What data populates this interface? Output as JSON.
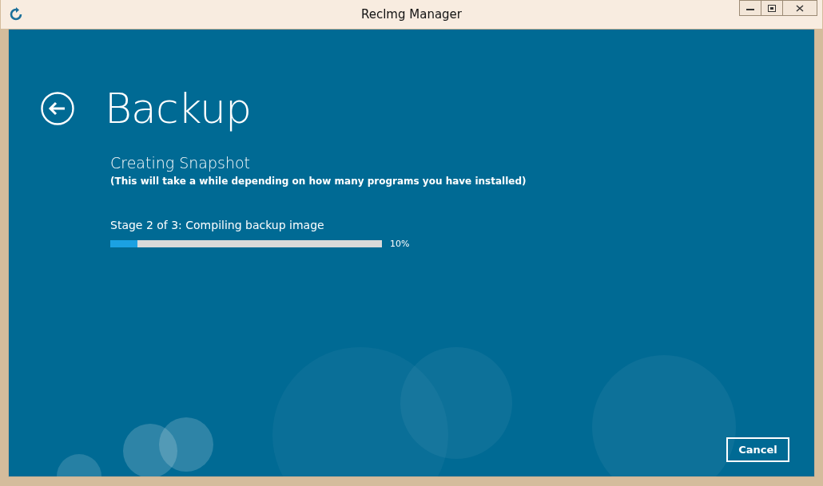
{
  "window": {
    "title": "Reclmg Manager"
  },
  "page": {
    "title": "Backup"
  },
  "status": {
    "heading": "Creating Snapshot",
    "note": "(This will take a while depending on how many programs you have installed)"
  },
  "progress": {
    "label": "Stage 2 of 3: Compiling backup image",
    "level": 0.1,
    "reading": "10%"
  },
  "buttons": [
    {
      "label": "Cancel"
    }
  ]
}
